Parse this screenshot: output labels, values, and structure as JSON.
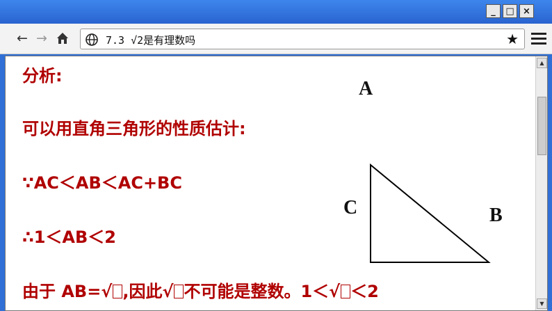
{
  "window": {
    "minimize_label": "_",
    "maximize_label": "□",
    "close_label": "×"
  },
  "toolbar": {
    "back_label": "←",
    "forward_label": "→",
    "home_label": "⌂",
    "url": "7.3 √2是有理数吗",
    "star_label": "★"
  },
  "slide": {
    "heading": "分析:",
    "line1": "可以用直角三角形的性质估计:",
    "line2": "∵AC＜AB＜AC+BC",
    "line3": "∴1＜AB＜2",
    "line4_a": "由于 AB=√",
    "line4_b": ",因此√",
    "line4_c": "不可能是整数。1＜√",
    "line4_d": "＜2",
    "vertex_a": "A",
    "vertex_b": "B",
    "vertex_c": "C"
  },
  "colors": {
    "titlebar": "#2f6fd6",
    "text_red": "#b00000"
  }
}
